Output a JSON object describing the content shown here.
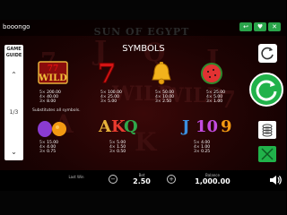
{
  "window": {
    "buttons": [
      "↩",
      "♥",
      "✕"
    ]
  },
  "brand": "booongo",
  "game_title": "SUN OF EGYPT",
  "left_panel": {
    "guide_label": [
      "GAME",
      "GUIDE"
    ],
    "page": "1/3"
  },
  "symbols_heading": "SYMBOLS",
  "symbols": [
    {
      "name": "WILD",
      "pays": [
        {
          "k": "5×",
          "v": "200.00"
        },
        {
          "k": "4×",
          "v": "40.00"
        },
        {
          "k": "3×",
          "v": "8.00"
        }
      ]
    },
    {
      "name": "7",
      "pays": [
        {
          "k": "5×",
          "v": "100.00"
        },
        {
          "k": "4×",
          "v": "25.00"
        },
        {
          "k": "3×",
          "v": "5.00"
        }
      ]
    },
    {
      "name": "bell",
      "pays": [
        {
          "k": "5×",
          "v": "50.00"
        },
        {
          "k": "4×",
          "v": "10.00"
        },
        {
          "k": "3×",
          "v": "2.50"
        }
      ]
    },
    {
      "name": "watermelon",
      "pays": [
        {
          "k": "5×",
          "v": "25.00"
        },
        {
          "k": "4×",
          "v": "5.00"
        },
        {
          "k": "3×",
          "v": "1.00"
        }
      ]
    },
    {
      "name": "plum-orange",
      "pays": [
        {
          "k": "5×",
          "v": "15.00"
        },
        {
          "k": "4×",
          "v": "4.00"
        },
        {
          "k": "3×",
          "v": "0.75"
        }
      ]
    },
    {
      "name": "AKQ",
      "letters": [
        "A",
        "K",
        "Q"
      ],
      "pays": [
        {
          "k": "5×",
          "v": "5.00"
        },
        {
          "k": "4×",
          "v": "1.50"
        },
        {
          "k": "3×",
          "v": "0.50"
        }
      ]
    },
    {
      "name": "J109",
      "letters": [
        "J",
        "10",
        "9"
      ],
      "pays": [
        {
          "k": "5×",
          "v": "4.00"
        },
        {
          "k": "4×",
          "v": "1.00"
        },
        {
          "k": "3×",
          "v": "0.25"
        }
      ]
    }
  ],
  "wild_note": "Substitutes all symbols.",
  "bottom": {
    "last_win_label": "Last Win",
    "bet_label": "Bet",
    "bet_value": "2.50",
    "balance_label": "Balance",
    "balance_value": "1,000.00"
  },
  "colors": {
    "spin_green": "#21b24a",
    "bg_red": "#2a0505"
  }
}
